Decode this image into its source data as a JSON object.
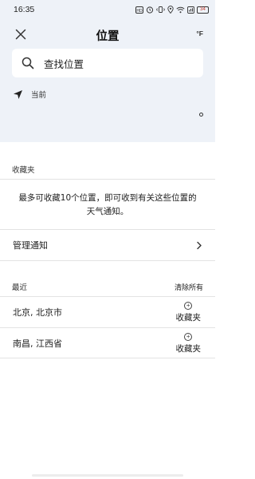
{
  "status_bar": {
    "time": "16:35",
    "battery": "34",
    "icons": [
      "hd-icon",
      "alarm-icon",
      "vibrate-icon",
      "location-pin-icon",
      "wifi-icon",
      "signal-box-icon",
      "battery-icon"
    ]
  },
  "header": {
    "title": "位置",
    "unit_toggle": "°F",
    "close_icon": "close-icon"
  },
  "search": {
    "placeholder": "查找位置",
    "icon": "search-icon"
  },
  "current_location": {
    "label": "当前",
    "icon": "navigation-arrow-icon"
  },
  "favorites": {
    "section_label": "收藏夹",
    "info": "最多可收藏10个位置，即可收到有关这些位置的天气通知。"
  },
  "manage": {
    "label": "管理通知",
    "icon": "chevron-right-icon"
  },
  "recent": {
    "section_label": "最近",
    "clear_all": "清除所有",
    "items": [
      {
        "name": "北京, 北京市",
        "action": "收藏夹"
      },
      {
        "name": "南昌, 江西省",
        "action": "收藏夹"
      }
    ]
  },
  "colors": {
    "top_background": "#eef2f8",
    "page_background": "#ffffff",
    "text": "#1a1a1a"
  }
}
